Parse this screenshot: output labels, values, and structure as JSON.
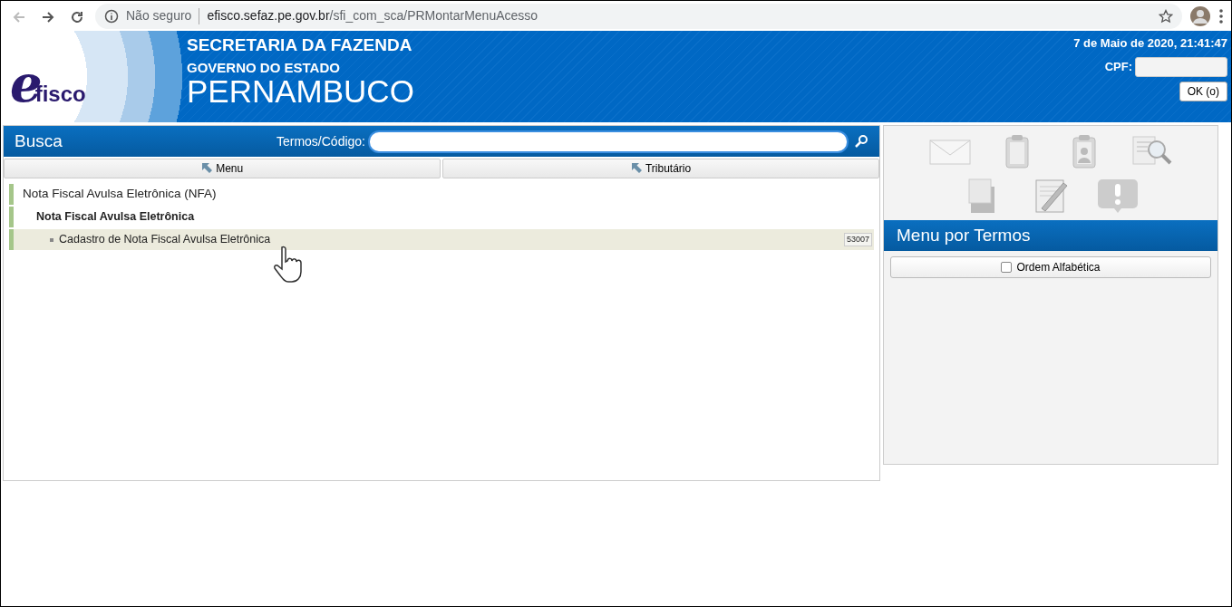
{
  "browser": {
    "security": "Não seguro",
    "url_host": "efisco.sefaz.pe.gov.br",
    "url_path": "/sfi_com_sca/PRMontarMenuAcesso"
  },
  "header": {
    "logo": {
      "initial": "e",
      "rest": "fisco"
    },
    "line_1": "SECRETARIA DA FAZENDA",
    "line_2": "GOVERNO DO ESTADO",
    "line_3": "PERNAMBUCO",
    "datetime": "7 de Maio de 2020, 21:41:47",
    "cpf_label": "CPF:",
    "ok_button": "OK (o)"
  },
  "search": {
    "title": "Busca",
    "label": "Termos/Código:"
  },
  "breadcrumbs": [
    "Menu",
    "Tributário"
  ],
  "tree": [
    {
      "label": "Nota Fiscal Avulsa Eletrônica (NFA)",
      "selected": false,
      "children": [
        {
          "label": "Nota Fiscal Avulsa Eletrônica",
          "selected": false,
          "children": [
            {
              "label": "Cadastro de Nota Fiscal Avulsa Eletrônica",
              "code": "53007",
              "selected": true
            }
          ]
        }
      ]
    }
  ],
  "terms_panel": {
    "title": "Menu por Termos",
    "sort_option": {
      "label": "Ordem Alfabética",
      "checked": false
    }
  }
}
